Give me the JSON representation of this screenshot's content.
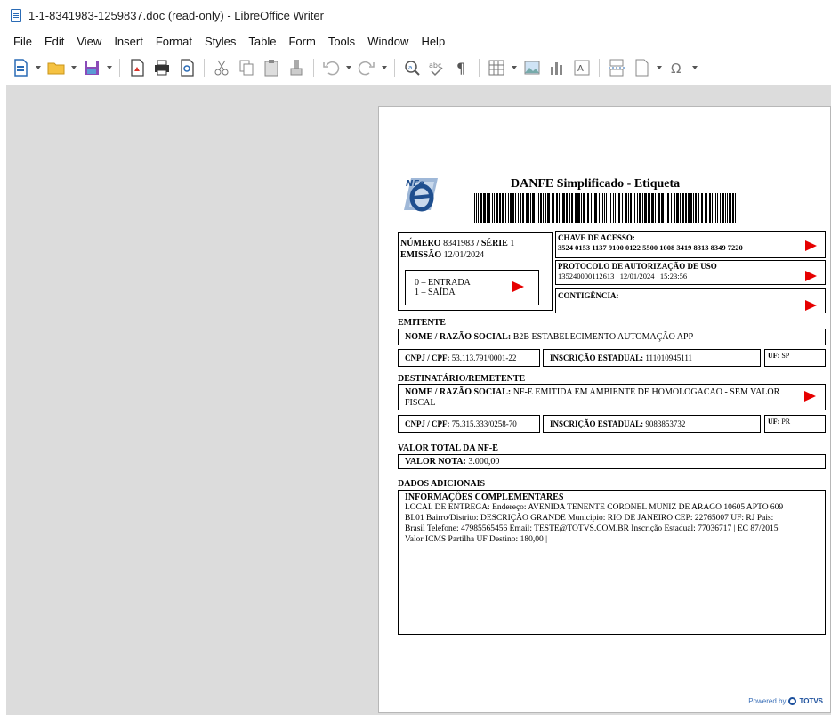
{
  "window": {
    "title": "1-1-8341983-1259837.doc (read-only) - LibreOffice Writer"
  },
  "menu": [
    "File",
    "Edit",
    "View",
    "Insert",
    "Format",
    "Styles",
    "Table",
    "Form",
    "Tools",
    "Window",
    "Help"
  ],
  "toolbar": {
    "icons": [
      "new-document-icon",
      "open-folder-icon",
      "save-icon",
      "export-pdf-icon",
      "print-icon",
      "print-preview-icon",
      "cut-icon",
      "copy-icon",
      "paste-icon",
      "clone-formatting-icon",
      "undo-icon",
      "redo-icon",
      "find-replace-icon",
      "spellcheck-icon",
      "formatting-marks-icon",
      "insert-table-icon",
      "insert-image-icon",
      "insert-chart-icon",
      "insert-textbox-icon",
      "page-break-icon",
      "field-icon",
      "special-character-icon"
    ]
  },
  "document": {
    "title": "DANFE Simplificado - Etiqueta",
    "logo_text": "NFe",
    "numero_label": "NÚMERO",
    "numero_value": "8341983",
    "serie_label": "/ SÉRIE",
    "serie_value": "1",
    "emissao_label": "EMISSÃO",
    "emissao_value": "12/01/2024",
    "entrada": "0 – ENTRADA",
    "saida": "1 – SAÍDA",
    "chave_label": "CHAVE DE ACESSO:",
    "chave_value": "3524 0153 1137 9100 0122 5500 1008 3419 8313 8349 7220",
    "protocolo_label": "PROTOCOLO DE AUTORIZAÇÃO DE USO",
    "protocolo_value": "135240000112613   12/01/2024   15:23:56",
    "contingencia_label": "CONTIGÊNCIA:",
    "emitente_section": "EMITENTE",
    "emitente_nome_label": "NOME / RAZÃO SOCIAL:",
    "emitente_nome_value": "B2B  ESTABELECIMENTO AUTOMAÇÃO APP",
    "emitente_cnpj_label": "CNPJ / CPF:",
    "emitente_cnpj_value": "53.113.791/0001-22",
    "emitente_ie_label": "INSCRIÇÃO ESTADUAL:",
    "emitente_ie_value": "111010945111",
    "emitente_uf_label": "UF:",
    "emitente_uf_value": "SP",
    "dest_section": "DESTINATÁRIO/REMETENTE",
    "dest_nome_label": "NOME / RAZÃO SOCIAL:",
    "dest_nome_value_1": "NF-E EMITIDA EM AMBIENTE DE HOMOLOGACAO - SEM VALOR",
    "dest_nome_value_2": "FISCAL",
    "dest_cnpj_label": "CNPJ / CPF:",
    "dest_cnpj_value": "75.315.333/0258-70",
    "dest_ie_label": "INSCRIÇÃO ESTADUAL:",
    "dest_ie_value": "9083853732",
    "dest_uf_label": "UF:",
    "dest_uf_value": "PR",
    "valor_section": "VALOR TOTAL DA NF-E",
    "valor_label": "VALOR NOTA:",
    "valor_value": "3.000,00",
    "dados_section": "DADOS ADICIONAIS",
    "info_label": "INFORMAÇÕES COMPLEMENTARES",
    "info_line_1": "LOCAL DE ENTREGA: Endereço: AVENIDA TENENTE CORONEL MUNIZ DE ARAGO 10605 APTO 609",
    "info_line_2": "BL01 Bairro/Distrito: DESCRIÇÃO GRANDE Municipio: RIO DE JANEIRO CEP: 22765007 UF: RJ Pais:",
    "info_line_3": "Brasil Telefone: 47985565456 Email: TESTE@TOTVS.COM.BR Inscrição Estadual: 77036717 | EC 87/2015",
    "info_line_4": "Valor ICMS Partilha UF Destino: 180,00 |",
    "powered_by": "Powered by",
    "powered_brand": "TOTVS"
  },
  "colors": {
    "accent_red": "#e60000",
    "workspace": "#dcdcdc",
    "brand_blue": "#1b4f9c"
  }
}
